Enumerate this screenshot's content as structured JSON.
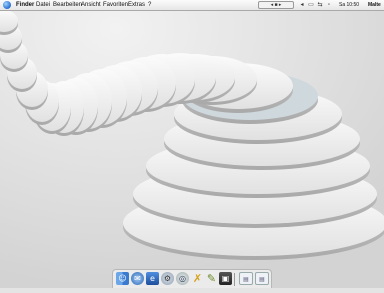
{
  "menubar": {
    "items": [
      "Finder",
      "Datei",
      "Bearbeiten",
      "Ansicht",
      "Favoriten",
      "Extras",
      "?"
    ],
    "clock": "Sa 10:50",
    "user": "Malte"
  },
  "dock": {
    "icons": [
      "finder-icon",
      "mail-icon",
      "internet-explorer-icon",
      "system-preferences-icon",
      "sherlock-icon",
      "ichat-icon",
      "textedit-icon",
      "imovie-icon",
      "trash-icon",
      "window-minimized-icon",
      "window-minimized-icon"
    ]
  },
  "colors": {
    "menubar": "#efefef",
    "desktop": "#e4e4e4",
    "selection": "#b9c9d6"
  }
}
